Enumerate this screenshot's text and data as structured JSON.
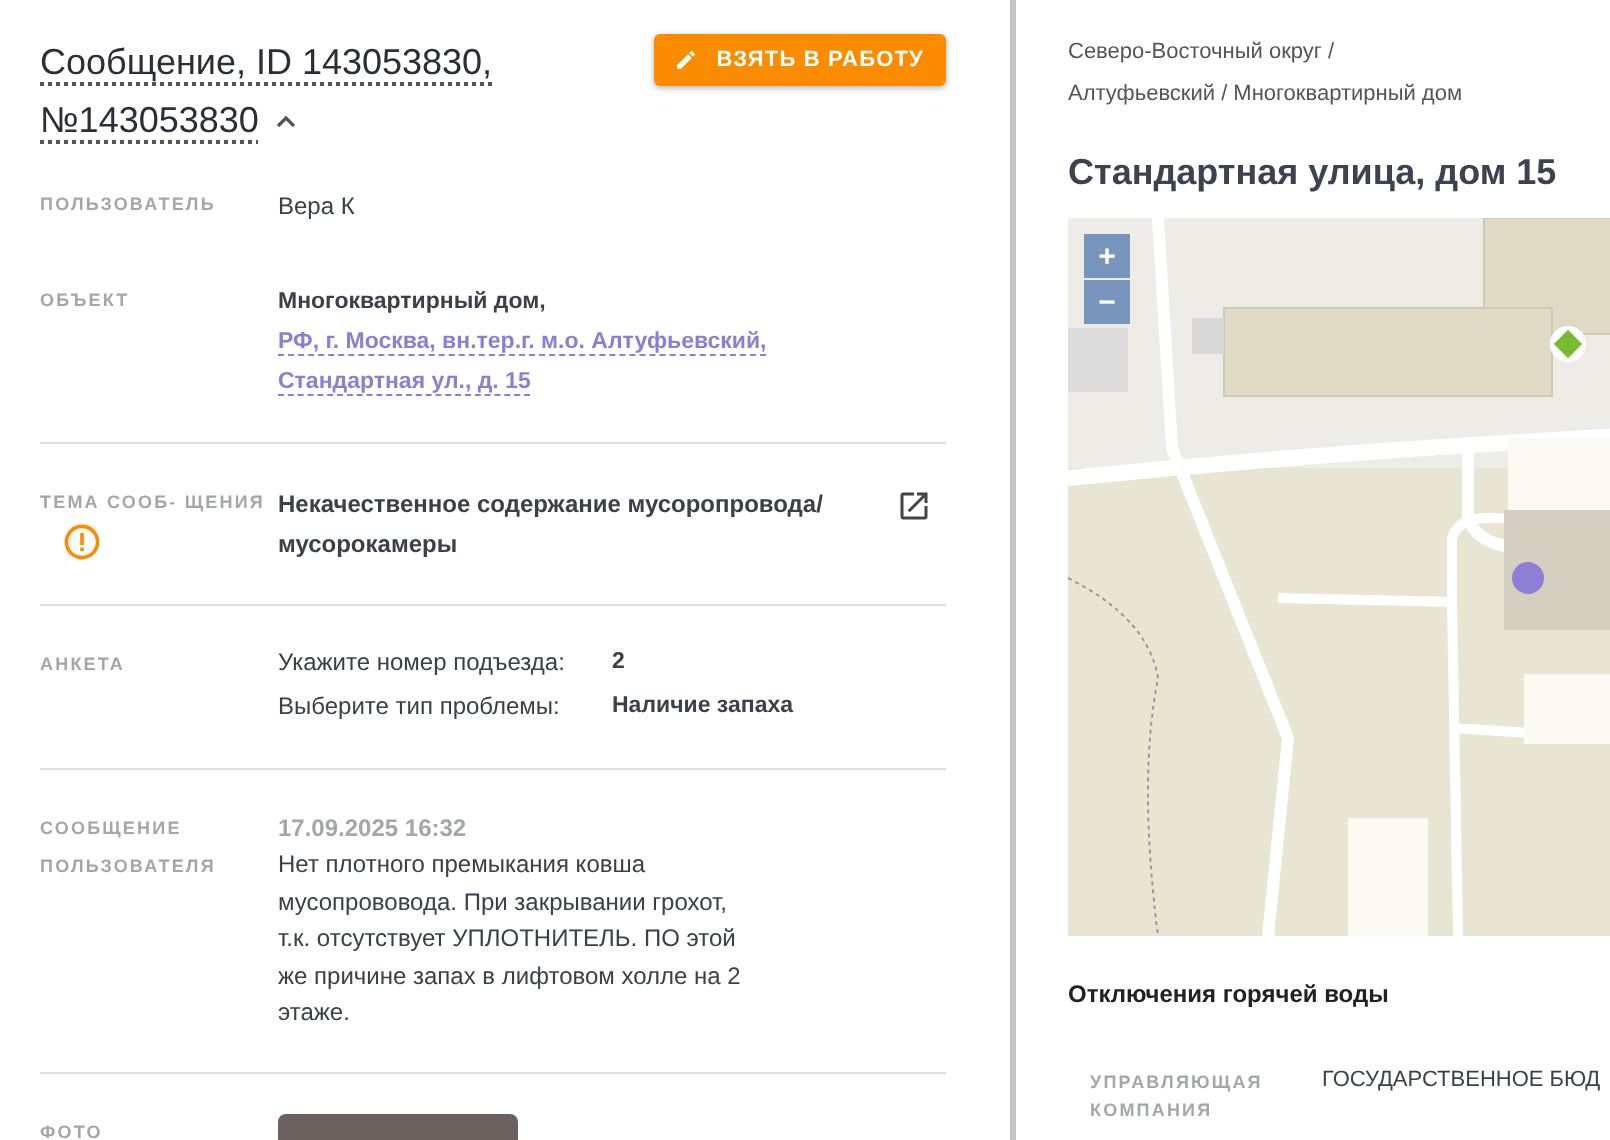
{
  "header": {
    "title_lines": [
      "Сообщение, ID 143053830,",
      "№143053830"
    ],
    "expanded": true,
    "action_button": "ВЗЯТЬ В РАБОТУ"
  },
  "sections": [
    {
      "rows": [
        {
          "kind": "text",
          "label": "ПОЛЬЗОВАТЕЛЬ",
          "value": "Вера К"
        },
        {
          "kind": "object",
          "label": "ОБЪЕКТ",
          "object_type": "Многоквартирный дом,",
          "address_link": "РФ, г. Москва, вн.тер.г. м.о. Алтуфьевский, Стандартная ул., д. 15"
        }
      ]
    },
    {
      "rows": [
        {
          "kind": "topic",
          "label": "ТЕМА СООБ- ЩЕНИЯ",
          "warning": true,
          "value": "Некачественное содержание мусоропровода/ мусорокамеры"
        }
      ]
    },
    {
      "rows": [
        {
          "kind": "survey",
          "label": "АНКЕТА",
          "answers": [
            {
              "question": "Укажите номер подъезда:",
              "answer": "2"
            },
            {
              "question": "Выберите тип проблемы:",
              "answer": "Наличие запаха"
            }
          ]
        }
      ]
    },
    {
      "rows": [
        {
          "kind": "message",
          "label": "СООБЩЕНИЕ ПОЛЬЗОВАТЕЛЯ",
          "date": "17.09.2025 16:32",
          "value": "Нет плотного премыкания ковша мусопрововода. При закрывании грохот, т.к. отсутствует УПЛОТНИТЕЛЬ. ПО этой же причине запах в лифтовом холле на 2 этаже."
        }
      ]
    },
    {
      "rows": [
        {
          "kind": "photo",
          "label": "ФОТО"
        }
      ]
    }
  ],
  "location": {
    "breadcrumb": "Северо-Восточный округ / Алтуфьевский / Многоквартирный дом",
    "title": "Стандартная улица, дом 15",
    "map": {
      "zoom_in": "+",
      "zoom_out": "−"
    }
  },
  "hot_water": {
    "title": "Отключения горячей воды",
    "rows": [
      {
        "label": "УПРАВЛЯЮЩАЯ КОМПАНИЯ",
        "value": "ГОСУДАРСТВЕННОЕ БЮД"
      }
    ]
  }
}
